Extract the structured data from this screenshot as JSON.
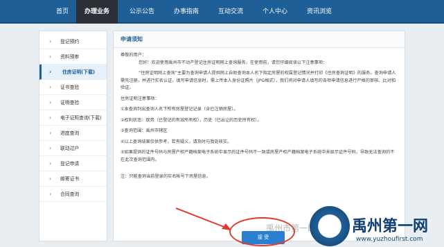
{
  "nav": {
    "items": [
      "首页",
      "办理业务",
      "公示公告",
      "办事指南",
      "互动交流",
      "个人中心",
      "资讯浏览"
    ],
    "active_index": 1
  },
  "sidebar": {
    "items": [
      "登记预约",
      "资料预审",
      "住房证明(下载)",
      "证书查验",
      "证明查验",
      "电子证照查询(下载)",
      "进度查询",
      "联动过户",
      "登记申请",
      "邮寄证书",
      "合同查询"
    ],
    "active_index": 2,
    "chevron": "›"
  },
  "panel": {
    "title": "申请须知"
  },
  "notice": {
    "greeting": "尊敬的用户：",
    "intro": "您好！欢迎使用禹州市不动产登记住房证明网上查询服务，在使用前，请您仔细阅读以下注意事项：",
    "description": "“住房证明网上查询”主要为查询申请人提供网上自助查询本人名下指定房屋的权属登记情况并打印《住房查询证明》的服务。查询申请人需先注册，并进行实名认证，填写申请信息时，需上传本人身份证照片（JPG格式），我们将对申请人填写的各项申请信息进行严格的审核、比对和验证。",
    "notes_title": "住房证明注意事项：",
    "note1": "①本查询列出查询人名下所有房屋登记记录（含已注销房屋）。",
    "note2": "②权利状态：现势（已登记的有效所有权），历史（已出让的历史所有权）。",
    "note3": "③查询范围：禹州市辖区",
    "note4": "④以上查询结果仅供参考，若有疑义，请及时与我处核实。",
    "note5": "⑤如果提供的证件号码与房屋产权产籍档案电子系统中显示的证件号码不一致或房屋产权产籍档案电子系统中未显示证件号码，导致无法查询的不在此次查询范围内。",
    "footer_note": "注：只能查询当前登录的实名帐号下房屋信息。"
  },
  "accept_button": "接 受",
  "watermark": {
    "brand": "禹州第一网",
    "url": "www.yuzhoufirst.com",
    "faint": "禹州市第一网"
  },
  "colors": {
    "nav": "#1f5f97",
    "nav_active": "#2c2f36",
    "button": "#2a7fd0",
    "annotation": "#e23b2e"
  }
}
